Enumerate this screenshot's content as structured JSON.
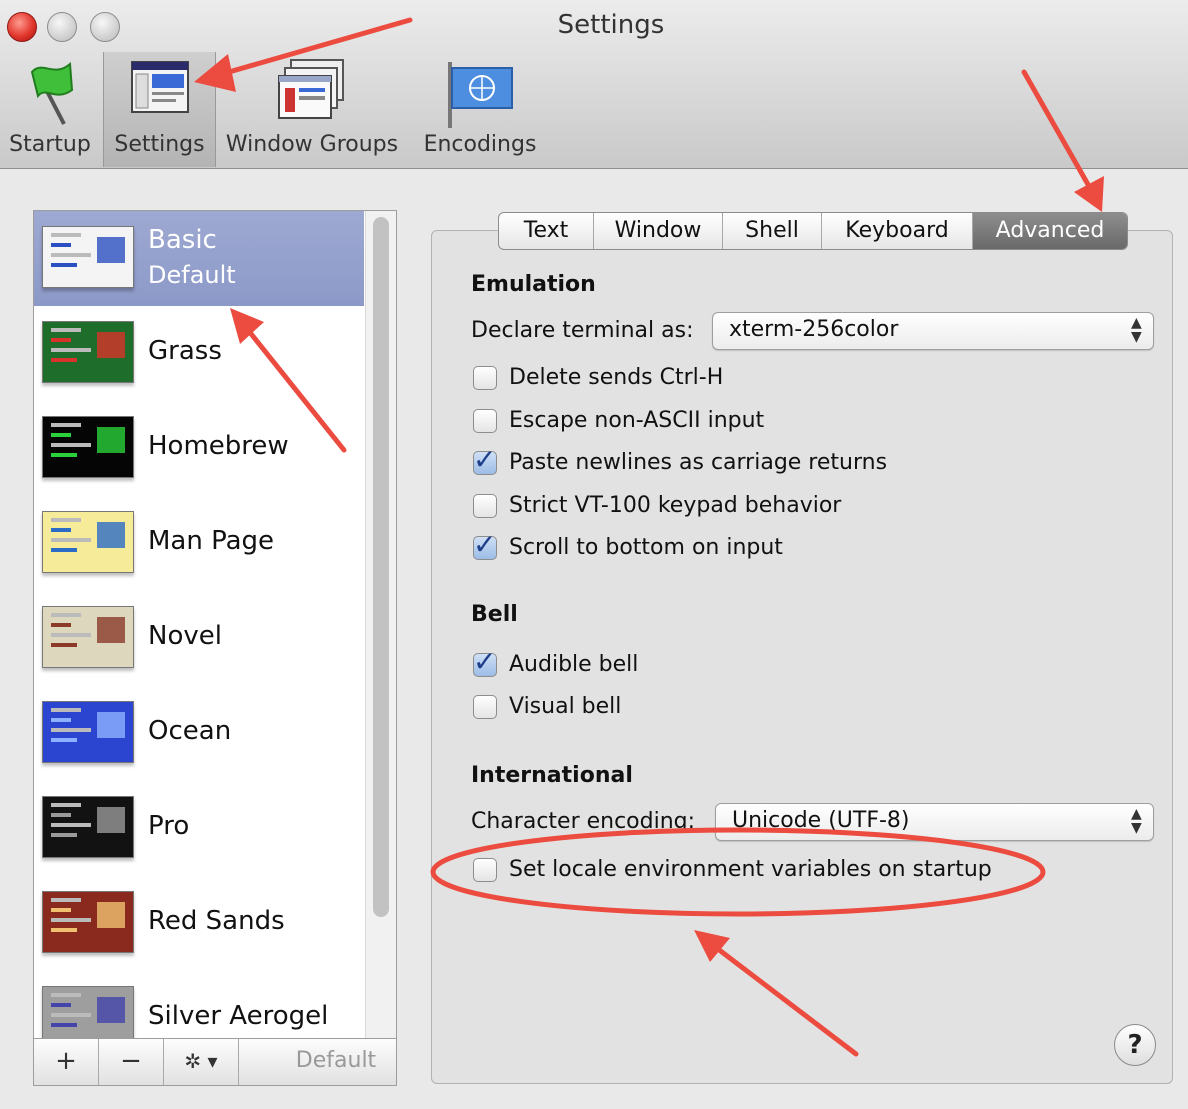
{
  "window": {
    "title": "Settings"
  },
  "toolbar": {
    "startup": "Startup",
    "settings": "Settings",
    "window_groups": "Window Groups",
    "encodings": "Encodings"
  },
  "profiles": [
    {
      "name": "Basic",
      "sub": "Default",
      "selected": true,
      "bg": "#f4f4f4",
      "accent": "#2a4fc0"
    },
    {
      "name": "Grass",
      "bg": "#1f6d2a",
      "accent": "#d8332b"
    },
    {
      "name": "Homebrew",
      "bg": "#050505",
      "accent": "#2bd13a"
    },
    {
      "name": "Man Page",
      "bg": "#f5eb99",
      "accent": "#2d6cc6"
    },
    {
      "name": "Novel",
      "bg": "#ddd7be",
      "accent": "#8b3a2a"
    },
    {
      "name": "Ocean",
      "bg": "#2b45d0",
      "accent": "#8fb0ff"
    },
    {
      "name": "Pro",
      "bg": "#121212",
      "accent": "#9a9a9a"
    },
    {
      "name": "Red Sands",
      "bg": "#8a2a1e",
      "accent": "#f0c070"
    },
    {
      "name": "Silver Aerogel",
      "bg": "#9e9e9e",
      "accent": "#4444aa"
    }
  ],
  "list_footer": {
    "add": "+",
    "remove": "−",
    "gear": "✲ ▾",
    "default": "Default"
  },
  "tabs": [
    "Text",
    "Window",
    "Shell",
    "Keyboard",
    "Advanced"
  ],
  "active_tab": "Advanced",
  "emulation": {
    "heading": "Emulation",
    "declare_label": "Declare terminal as:",
    "declare_value": "xterm-256color",
    "options": [
      {
        "label": "Delete sends Ctrl-H",
        "checked": false
      },
      {
        "label": "Escape non-ASCII input",
        "checked": false
      },
      {
        "label": "Paste newlines as carriage returns",
        "checked": true
      },
      {
        "label": "Strict VT-100 keypad behavior",
        "checked": false
      },
      {
        "label": "Scroll to bottom on input",
        "checked": true
      }
    ]
  },
  "bell": {
    "heading": "Bell",
    "options": [
      {
        "label": "Audible bell",
        "checked": true
      },
      {
        "label": "Visual bell",
        "checked": false
      }
    ]
  },
  "international": {
    "heading": "International",
    "encoding_label": "Character encoding:",
    "encoding_value": "Unicode (UTF-8)",
    "locale_label": "Set locale environment variables on startup",
    "locale_checked": false
  },
  "help_label": "?",
  "checkmark": "✓",
  "popup_arrows": "▲▼",
  "annotation_color": "#ec4b3f"
}
